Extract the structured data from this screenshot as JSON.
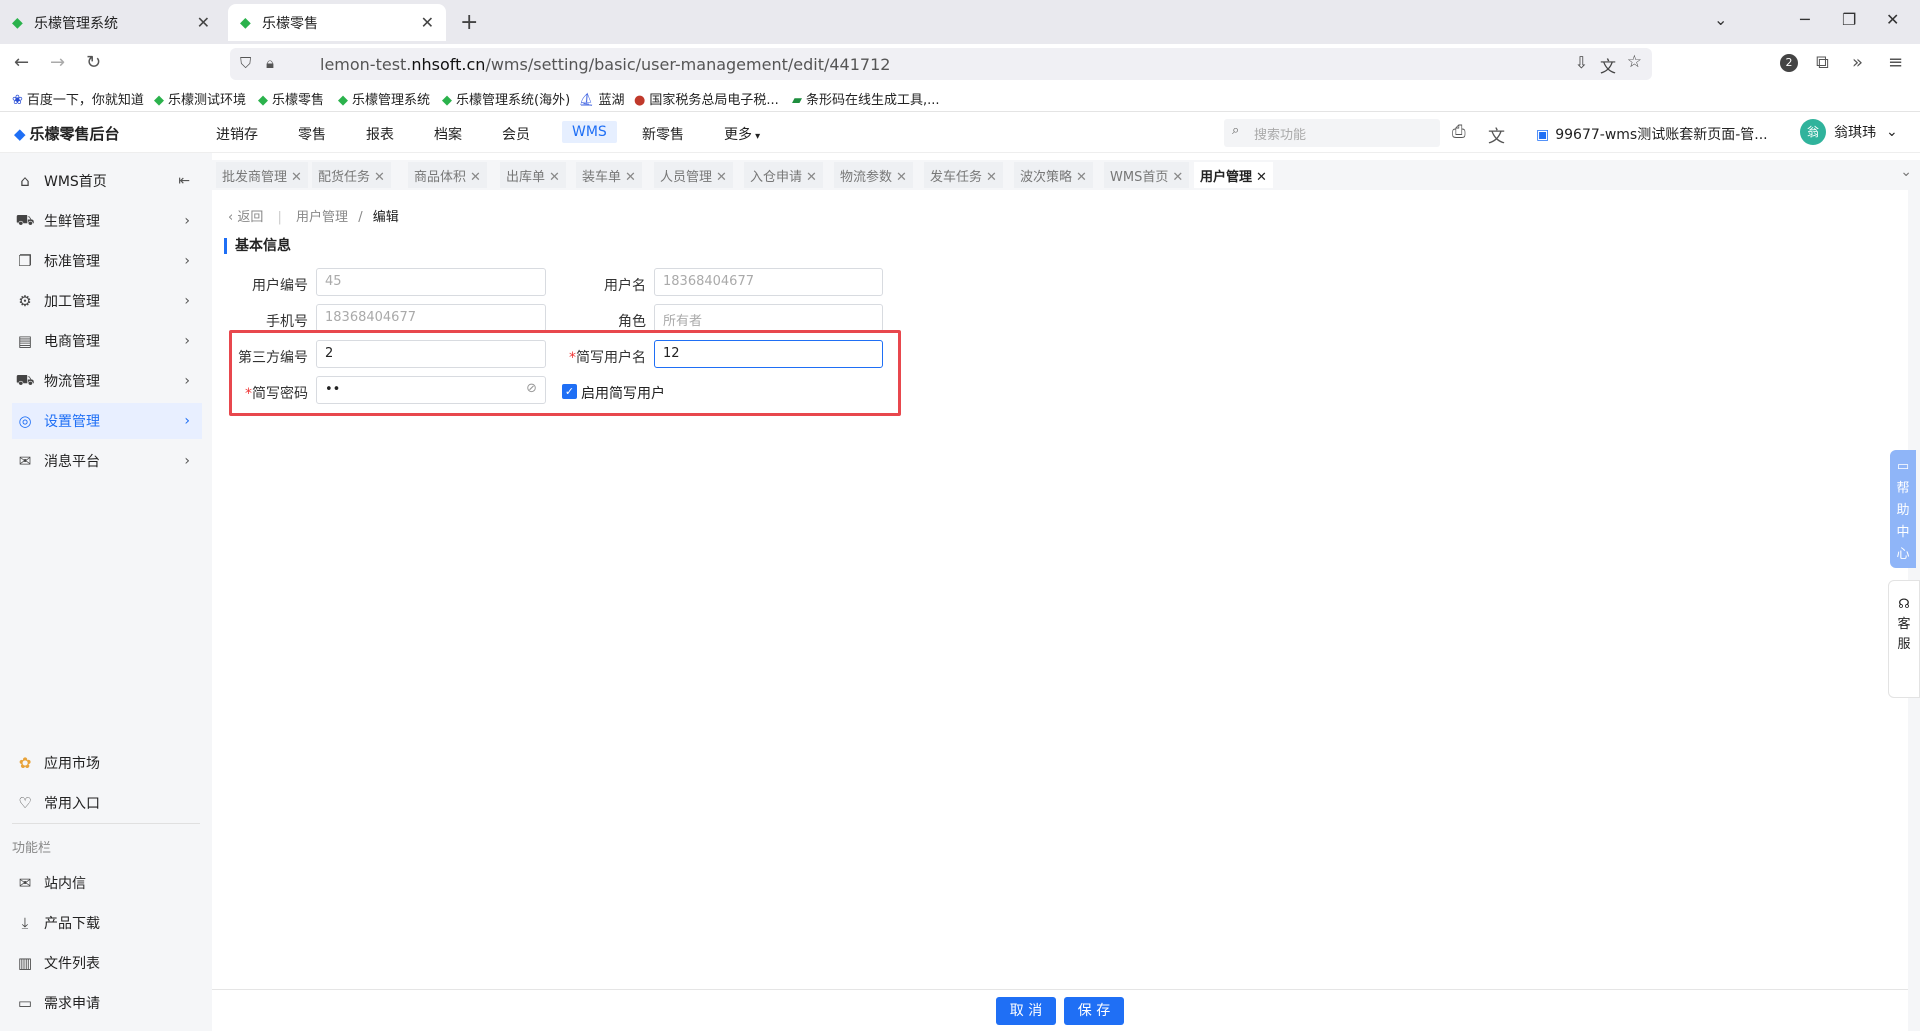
{
  "browser": {
    "tabs": [
      {
        "title": "乐檬管理系统",
        "active": false
      },
      {
        "title": "乐檬零售",
        "active": true
      }
    ],
    "url_prefix": "lemon-test.",
    "url_domain": "nhsoft.cn",
    "url_path": "/wms/setting/basic/user-management/edit/441712",
    "extension_badge": "2",
    "bookmarks": [
      "百度一下，你就知道",
      "乐檬测试环境",
      "乐檬零售",
      "乐檬管理系统",
      "乐檬管理系统(海外)",
      "蓝湖",
      "国家税务总局电子税...",
      "条形码在线生成工具,..."
    ]
  },
  "app": {
    "brand": "乐檬零售后台",
    "menu": [
      "进销存",
      "零售",
      "报表",
      "档案",
      "会员",
      "WMS",
      "新零售",
      "更多"
    ],
    "active_menu": "WMS",
    "search_placeholder": "搜索功能",
    "account": "99677-wms测试账套新页面-管...",
    "user_name": "翁琪玮",
    "avatar_text": "翁"
  },
  "sidebar": {
    "items": [
      {
        "label": "WMS首页",
        "icon": "home-icon"
      },
      {
        "label": "生鲜管理",
        "icon": "fresh-icon"
      },
      {
        "label": "标准管理",
        "icon": "standard-icon"
      },
      {
        "label": "加工管理",
        "icon": "process-icon"
      },
      {
        "label": "电商管理",
        "icon": "ecommerce-icon"
      },
      {
        "label": "物流管理",
        "icon": "logistics-icon"
      },
      {
        "label": "设置管理",
        "icon": "settings-icon",
        "active": true
      },
      {
        "label": "消息平台",
        "icon": "message-icon"
      }
    ],
    "bottom_items": [
      {
        "label": "应用市场",
        "icon": "app-market-icon"
      },
      {
        "label": "常用入口",
        "icon": "heart-icon"
      }
    ],
    "func_label": "功能栏",
    "func_items": [
      {
        "label": "站内信",
        "icon": "mail-icon"
      },
      {
        "label": "产品下载",
        "icon": "download-icon"
      },
      {
        "label": "文件列表",
        "icon": "file-list-icon"
      },
      {
        "label": "需求申请",
        "icon": "request-icon"
      }
    ]
  },
  "page_tabs": [
    "批发商管理",
    "配货任务",
    "商品体积",
    "出库单",
    "装车单",
    "人员管理",
    "入仓申请",
    "物流参数",
    "发车任务",
    "波次策略",
    "WMS首页",
    "用户管理"
  ],
  "active_page_tab": "用户管理",
  "breadcrumb": {
    "back": "返回",
    "parent": "用户管理",
    "sep": "/",
    "current": "编辑"
  },
  "section_title": "基本信息",
  "form": {
    "user_id_label": "用户编号",
    "user_id": "45",
    "username_label": "用户名",
    "username": "18368404677",
    "phone_label": "手机号",
    "phone": "18368404677",
    "role_label": "角色",
    "role": "所有者",
    "third_party_label": "第三方编号",
    "third_party": "2",
    "short_user_label": "简写用户名",
    "short_user": "12",
    "short_pwd_label": "简写密码",
    "short_pwd": "••",
    "enable_short_label": "启用简写用户",
    "enable_short": true
  },
  "footer": {
    "cancel": "取 消",
    "save": "保 存"
  },
  "help_center": [
    "帮",
    "助",
    "中",
    "心"
  ],
  "service": [
    "客",
    "服"
  ],
  "colors": {
    "accent": "#1f6ff5",
    "highlight": "#e8474d"
  }
}
